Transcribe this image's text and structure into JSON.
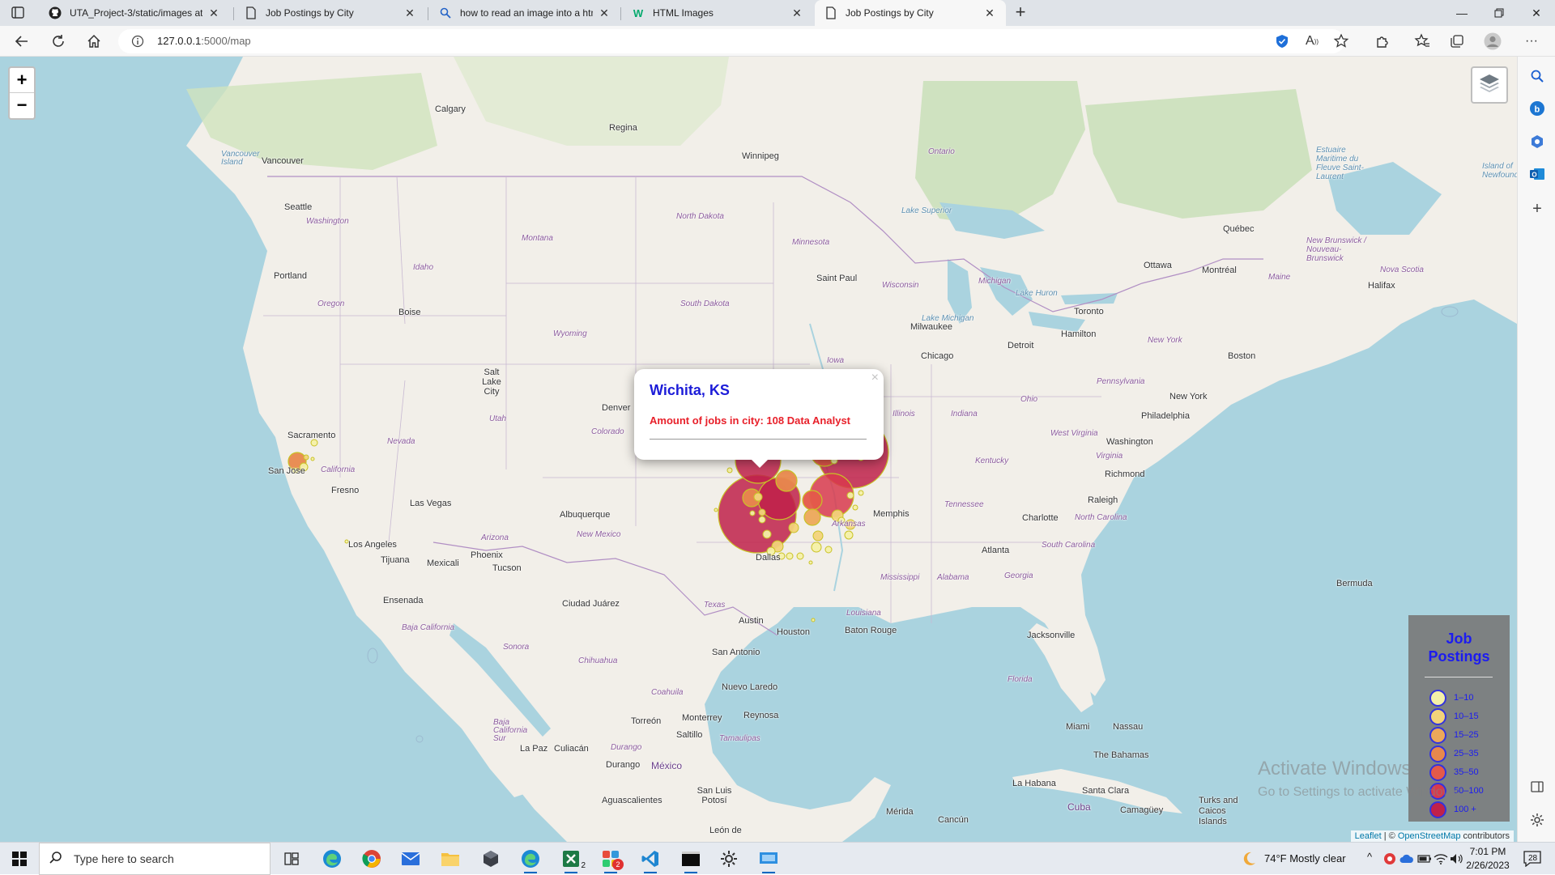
{
  "browser": {
    "tabs": [
      {
        "title": "UTA_Project-3/static/images at m",
        "icon": "github-icon",
        "active": false
      },
      {
        "title": "Job Postings by City",
        "icon": "page-icon",
        "active": false
      },
      {
        "title": "how to read an image into a htm",
        "icon": "search-icon",
        "active": false
      },
      {
        "title": "HTML Images",
        "icon": "w3schools-icon",
        "active": false
      },
      {
        "title": "Job Postings by City",
        "icon": "page-icon",
        "active": true
      }
    ],
    "url_host": "127.0.0.1",
    "url_path": ":5000/map"
  },
  "map": {
    "zoom_in": "+",
    "zoom_out": "−",
    "labels": {
      "calgary": "Calgary",
      "regina": "Regina",
      "winnipeg": "Winnipeg",
      "ontario": "Ontario",
      "vancouver_island": "Vancouver Island",
      "vancouver": "Vancouver",
      "seattle": "Seattle",
      "washington": "Washington",
      "montana": "Montana",
      "north_dakota": "North Dakota",
      "minnesota": "Minnesota",
      "lake_superior": "Lake Superior",
      "quebec": "Québec",
      "estuaire": "Estuaire Maritime du Fleuve Saint-Laurent",
      "island_newfoundland": "Island of Newfoundland",
      "new_brunswick": "New Brunswick / Nouveau-Brunswick",
      "nova_scotia": "Nova Scotia",
      "halifax": "Halifax",
      "maine": "Maine",
      "ottawa": "Ottawa",
      "montreal": "Montréal",
      "portland": "Portland",
      "idaho": "Idaho",
      "oregon": "Oregon",
      "boise": "Boise",
      "south_dakota": "South Dakota",
      "saint_paul": "Saint Paul",
      "wisconsin": "Wisconsin",
      "michigan": "Michigan",
      "lake_huron": "Lake Huron",
      "toronto": "Toronto",
      "hamilton": "Hamilton",
      "new_york_state": "New York",
      "boston": "Boston",
      "wyoming": "Wyoming",
      "lake_michigan": "Lake Michigan",
      "milwaukee": "Milwaukee",
      "detroit": "Detroit",
      "salt_lake_city": "Salt Lake City",
      "iowa": "Iowa",
      "chicago": "Chicago",
      "pennsylvania": "Pennsylvania",
      "new_york": "New York",
      "ohio": "Ohio",
      "denver": "Denver",
      "philadelphia": "Philadelphia",
      "sacramento": "Sacramento",
      "utah": "Utah",
      "colorado": "Colorado",
      "illinois": "Illinois",
      "indiana": "Indiana",
      "west_virginia": "West Virginia",
      "washington_dc": "Washington",
      "nevada": "Nevada",
      "virginia": "Virginia",
      "san_jose": "San Jose",
      "california": "California",
      "kentucky": "Kentucky",
      "richmond": "Richmond",
      "fresno": "Fresno",
      "raleigh": "Raleigh",
      "las_vegas": "Las Vegas",
      "albuquerque": "Albuquerque",
      "memphis": "Memphis",
      "tennessee": "Tennessee",
      "charlotte": "Charlotte",
      "north_carolina": "North Carolina",
      "arizona": "Arizona",
      "new_mexico": "New Mexico",
      "arkansas": "Arkansas",
      "los_angeles": "Los Angeles",
      "south_carolina": "South Carolina",
      "atlanta": "Atlanta",
      "phoenix": "Phoenix",
      "dallas": "Dallas",
      "tijuana": "Tijuana",
      "mexicali": "Mexicali",
      "tucson": "Tucson",
      "mississippi": "Mississippi",
      "alabama": "Alabama",
      "georgia": "Georgia",
      "ensenada": "Ensenada",
      "ciudad_juarez": "Ciudad Juárez",
      "texas": "Texas",
      "bermuda": "Bermuda",
      "louisiana": "Louisiana",
      "austin": "Austin",
      "baja_california": "Baja California",
      "houston": "Houston",
      "baton_rouge": "Baton Rouge",
      "jacksonville": "Jacksonville",
      "sonora": "Sonora",
      "chihuahua": "Chihuahua",
      "san_antonio": "San Antonio",
      "florida": "Florida",
      "coahuila": "Coahuila",
      "nuevo_laredo": "Nuevo Laredo",
      "monterrey": "Monterrey",
      "reynosa": "Reynosa",
      "baja_california_sur": "Baja California Sur",
      "torreon": "Torreón",
      "saltillo": "Saltillo",
      "miami": "Miami",
      "nassau": "Nassau",
      "tamaulipas": "Tamaulipas",
      "durango_state": "Durango",
      "la_paz": "La Paz",
      "culiacan": "Culiacán",
      "the_bahamas": "The Bahamas",
      "durango": "Durango",
      "mexico": "México",
      "la_habana": "La Habana",
      "santa_clara": "Santa Clara",
      "aguascalientes": "Aguascalientes",
      "san_luis_potosi": "San Luis Potosí",
      "turks_caicos": "Turks and Caicos Islands",
      "cuba": "Cuba",
      "camaguey": "Camagüey",
      "merida": "Mérida",
      "cancun": "Cancún",
      "leon": "León de"
    },
    "popup": {
      "city": "Wichita, KS",
      "jobs_text": "Amount of jobs in city: 108 Data Analyst",
      "close": "×"
    },
    "legend": {
      "title_line1": "Job",
      "title_line2": "Postings",
      "items": [
        {
          "label": "1–10",
          "color": "#f4f0a8"
        },
        {
          "label": "10–15",
          "color": "#f2d37a"
        },
        {
          "label": "15–25",
          "color": "#eca85a"
        },
        {
          "label": "25–35",
          "color": "#e8884d"
        },
        {
          "label": "35–50",
          "color": "#e45a4a"
        },
        {
          "label": "50–100",
          "color": "#d83a4d"
        },
        {
          "label": "100 +",
          "color": "#c0214a"
        }
      ]
    },
    "watermark_title": "Activate Windows",
    "watermark_sub": "Go to Settings to activate Windows.",
    "attribution_leaflet": "Leaflet",
    "attribution_sep": " | © ",
    "attribution_osm": "OpenStreetMap",
    "attribution_tail": " contributors"
  },
  "taskbar": {
    "search_placeholder": "Type here to search",
    "weather": "74°F  Mostly clear",
    "time": "7:01 PM",
    "date": "2/26/2023",
    "notifications": "28",
    "badge_excel": "2",
    "badge_app": "2"
  }
}
